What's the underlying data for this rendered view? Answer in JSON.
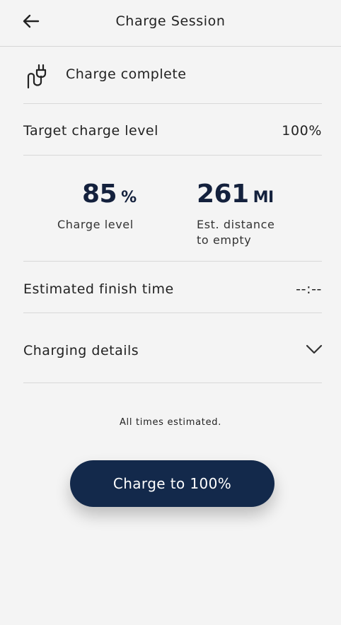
{
  "header": {
    "title": "Charge Session"
  },
  "status": {
    "text": "Charge complete",
    "icon": "plug-icon"
  },
  "target": {
    "label": "Target charge level",
    "value": "100%"
  },
  "stats": {
    "charge": {
      "value": "85",
      "unit": "%",
      "label": "Charge level"
    },
    "distance": {
      "value": "261",
      "unit": "MI",
      "label_line1": "Est. distance",
      "label_line2": "to empty"
    }
  },
  "finish": {
    "label": "Estimated finish time",
    "value": "--:--"
  },
  "details": {
    "label": "Charging details"
  },
  "note": "All times estimated.",
  "cta": {
    "label": "Charge to 100%"
  },
  "colors": {
    "background": "#f4f4f4",
    "accent": "#13294b",
    "stat_text": "#14213d"
  }
}
